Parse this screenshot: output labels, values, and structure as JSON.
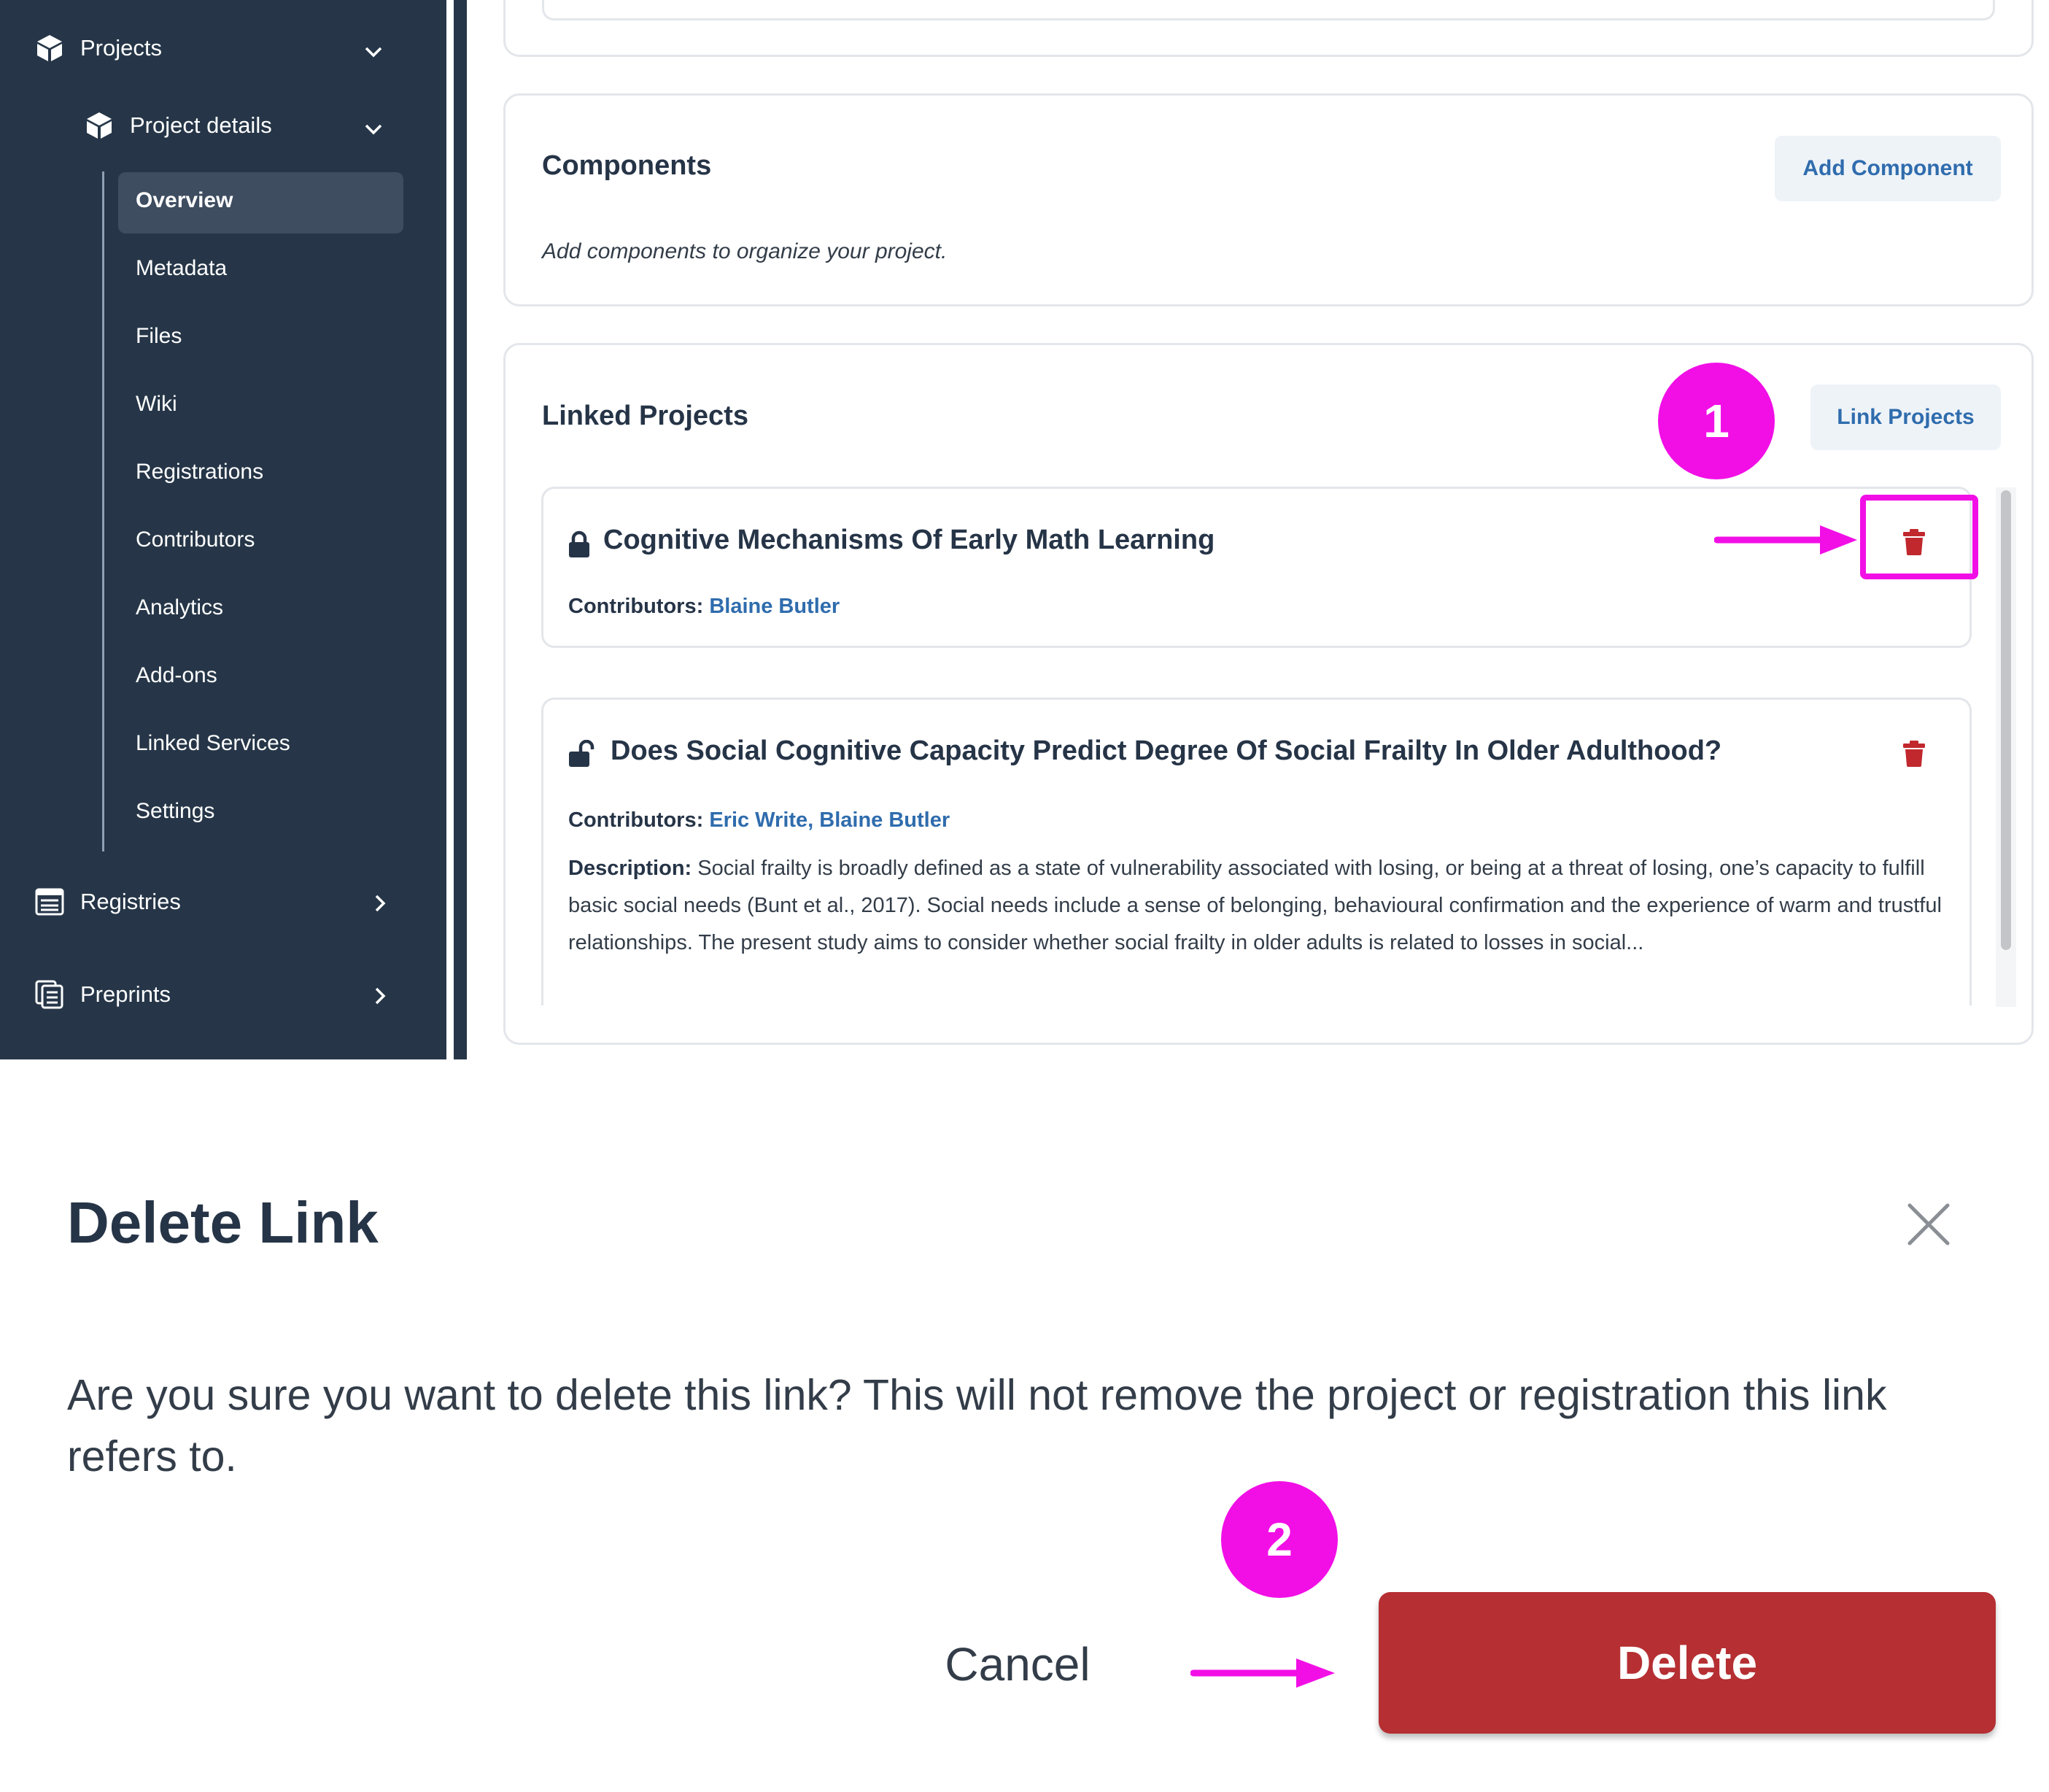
{
  "sidebar": {
    "projects_label": "Projects",
    "project_details_label": "Project details",
    "items": [
      {
        "label": "Overview",
        "active": true
      },
      {
        "label": "Metadata"
      },
      {
        "label": "Files"
      },
      {
        "label": "Wiki"
      },
      {
        "label": "Registrations"
      },
      {
        "label": "Contributors"
      },
      {
        "label": "Analytics"
      },
      {
        "label": "Add-ons"
      },
      {
        "label": "Linked Services"
      },
      {
        "label": "Settings"
      }
    ],
    "registries_label": "Registries",
    "preprints_label": "Preprints"
  },
  "components": {
    "title": "Components",
    "add_button": "Add Component",
    "hint": "Add components to organize your project."
  },
  "linked_projects": {
    "title": "Linked Projects",
    "link_button": "Link Projects",
    "items": [
      {
        "title": "Cognitive Mechanisms Of Early Math Learning",
        "icon": "lock-icon",
        "contributors_label": "Contributors:",
        "contributors": "Blaine Butler"
      },
      {
        "title": "Does Social Cognitive Capacity Predict Degree Of Social Frailty In Older Adulthood?",
        "icon": "unlock-icon",
        "contributors_label": "Contributors:",
        "contributors": "Eric Write, Blaine Butler",
        "description_label": "Description:",
        "description": "Social frailty is broadly defined as a state of vulnerability associated with losing, or being at a threat of losing, one’s capacity to fulfill basic social needs (Bunt et al., 2017). Social needs include a sense of belonging, behavioural confirmation and the experience of warm and trustful relationships. The present study aims to consider whether social frailty in older adults is related to losses in social..."
      }
    ]
  },
  "annotations": {
    "step1": "1",
    "step2": "2",
    "color": "#f20fe6"
  },
  "dialog": {
    "title": "Delete Link",
    "body": "Are you sure you want to delete this link? This will not remove the project or registration this link refers to.",
    "cancel_label": "Cancel",
    "delete_label": "Delete"
  },
  "colors": {
    "sidebar_bg": "#263648",
    "link_blue": "#2f6cad",
    "danger": "#b52f33"
  }
}
